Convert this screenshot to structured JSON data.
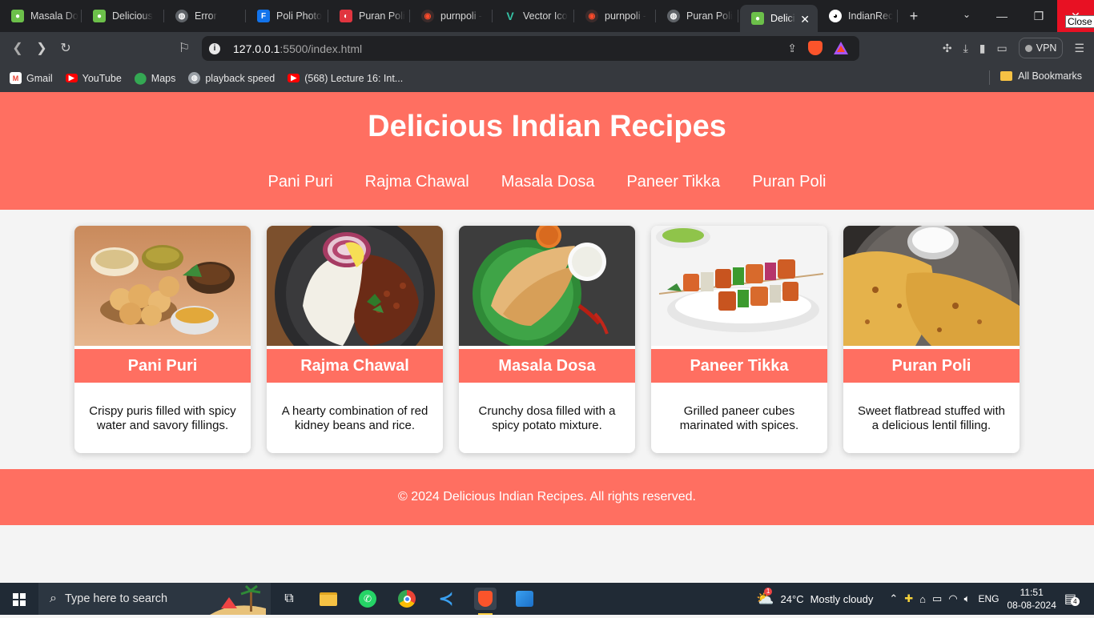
{
  "browser": {
    "tabs": [
      {
        "title": "Masala Do",
        "icon": "recipe-favicon",
        "color": "#6cc04a"
      },
      {
        "title": "Delicious",
        "icon": "recipe-favicon",
        "color": "#6cc04a"
      },
      {
        "title": "Error",
        "icon": "globe-icon",
        "color": "#9aa0a6"
      },
      {
        "title": "Poli Photo",
        "icon": "freepik-favicon",
        "color": "#1273eb"
      },
      {
        "title": "Puran Poli",
        "icon": "puran-favicon",
        "color": "#e0353f"
      },
      {
        "title": "purnpoli -",
        "icon": "brave-search-favicon",
        "color": "#ff4b2b"
      },
      {
        "title": "Vector Ico",
        "icon": "vector-icon-favicon",
        "color": "#35c1a4"
      },
      {
        "title": "purnpoli -",
        "icon": "brave-search-favicon",
        "color": "#ff4b2b"
      },
      {
        "title": "Puran Poli",
        "icon": "globe-icon",
        "color": "#9aa0a6"
      },
      {
        "title": "Delici",
        "icon": "recipe-favicon",
        "color": "#6cc04a",
        "active": true
      },
      {
        "title": "IndianRec",
        "icon": "github-icon",
        "color": "#ffffff"
      }
    ],
    "url_host": "127.0.0.1",
    "url_path": ":5500/index.html",
    "vpn_label": "VPN",
    "close_tooltip": "Close",
    "bookmarks": [
      {
        "label": "Gmail",
        "icon": "gmail-icon",
        "color": "#ea4335"
      },
      {
        "label": "YouTube",
        "icon": "youtube-icon",
        "color": "#ff0000"
      },
      {
        "label": "Maps",
        "icon": "maps-icon",
        "color": "#34a853"
      },
      {
        "label": "playback speed",
        "icon": "globe-icon",
        "color": "#9aa0a6"
      },
      {
        "label": "(568) Lecture 16: Int...",
        "icon": "youtube-icon",
        "color": "#ff0000"
      }
    ],
    "all_bookmarks": "All Bookmarks"
  },
  "site": {
    "title": "Delicious Indian Recipes",
    "nav": [
      "Pani Puri",
      "Rajma Chawal",
      "Masala Dosa",
      "Paneer Tikka",
      "Puran Poli"
    ],
    "cards": [
      {
        "name": "Pani Puri",
        "desc": "Crispy puris filled with spicy water and savory fillings.",
        "photo": "pani-puri-photo"
      },
      {
        "name": "Rajma Chawal",
        "desc": "A hearty combination of red kidney beans and rice.",
        "photo": "rajma-chawal-photo"
      },
      {
        "name": "Masala Dosa",
        "desc": "Crunchy dosa filled with a spicy potato mixture.",
        "photo": "masala-dosa-photo"
      },
      {
        "name": "Paneer Tikka",
        "desc": "Grilled paneer cubes marinated with spices.",
        "photo": "paneer-tikka-photo"
      },
      {
        "name": "Puran Poli",
        "desc": "Sweet flatbread stuffed with a delicious lentil filling.",
        "photo": "puran-poli-photo"
      }
    ],
    "footer": "© 2024 Delicious Indian Recipes. All rights reserved.",
    "accent": "#ff6f61"
  },
  "taskbar": {
    "search_placeholder": "Type here to search",
    "weather_temp": "24°C",
    "weather_desc": "Mostly cloudy",
    "weather_badge": "1",
    "language": "ENG",
    "time": "11:51",
    "date": "08-08-2024",
    "notif_count": "4"
  }
}
